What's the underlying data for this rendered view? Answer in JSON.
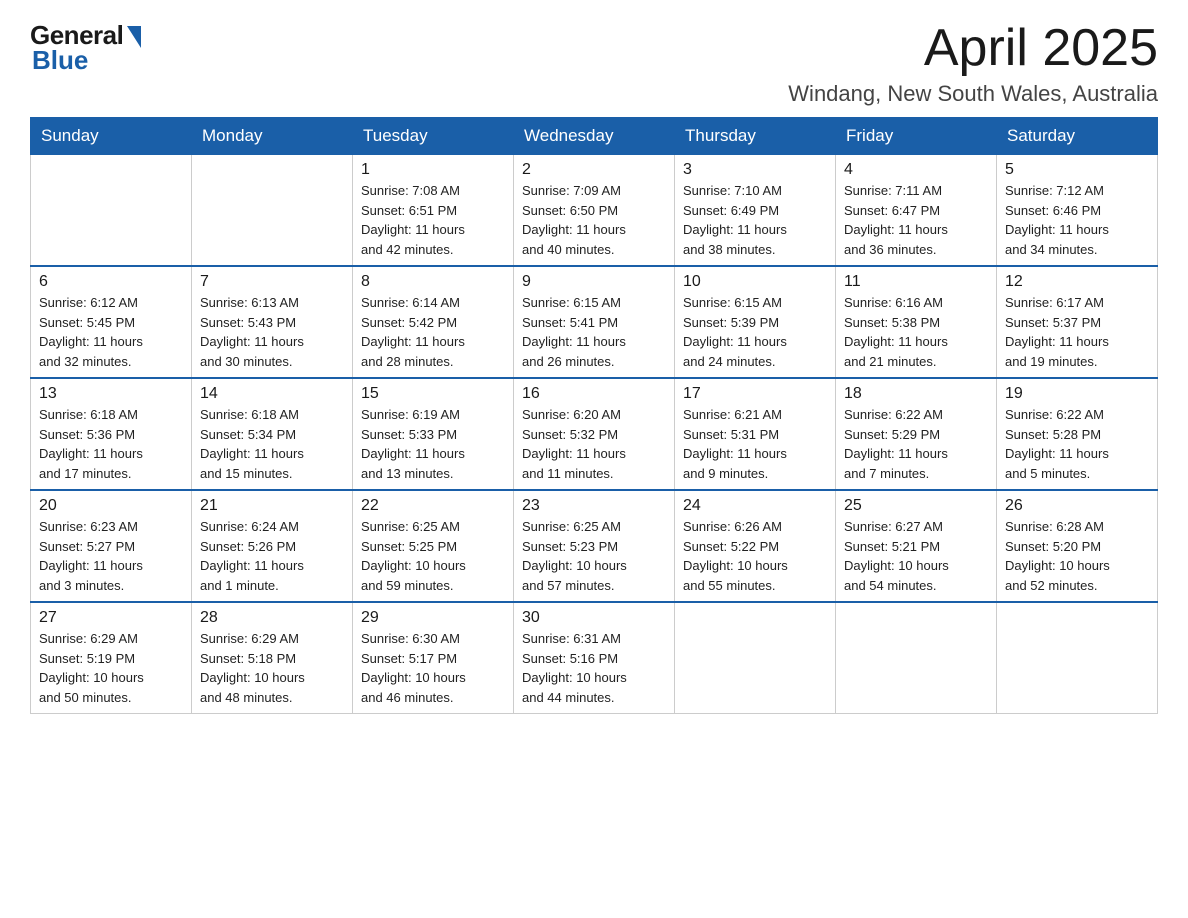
{
  "logo": {
    "general": "General",
    "blue": "Blue"
  },
  "title": "April 2025",
  "location": "Windang, New South Wales, Australia",
  "days_header": [
    "Sunday",
    "Monday",
    "Tuesday",
    "Wednesday",
    "Thursday",
    "Friday",
    "Saturday"
  ],
  "weeks": [
    [
      {
        "day": "",
        "info": ""
      },
      {
        "day": "",
        "info": ""
      },
      {
        "day": "1",
        "info": "Sunrise: 7:08 AM\nSunset: 6:51 PM\nDaylight: 11 hours\nand 42 minutes."
      },
      {
        "day": "2",
        "info": "Sunrise: 7:09 AM\nSunset: 6:50 PM\nDaylight: 11 hours\nand 40 minutes."
      },
      {
        "day": "3",
        "info": "Sunrise: 7:10 AM\nSunset: 6:49 PM\nDaylight: 11 hours\nand 38 minutes."
      },
      {
        "day": "4",
        "info": "Sunrise: 7:11 AM\nSunset: 6:47 PM\nDaylight: 11 hours\nand 36 minutes."
      },
      {
        "day": "5",
        "info": "Sunrise: 7:12 AM\nSunset: 6:46 PM\nDaylight: 11 hours\nand 34 minutes."
      }
    ],
    [
      {
        "day": "6",
        "info": "Sunrise: 6:12 AM\nSunset: 5:45 PM\nDaylight: 11 hours\nand 32 minutes."
      },
      {
        "day": "7",
        "info": "Sunrise: 6:13 AM\nSunset: 5:43 PM\nDaylight: 11 hours\nand 30 minutes."
      },
      {
        "day": "8",
        "info": "Sunrise: 6:14 AM\nSunset: 5:42 PM\nDaylight: 11 hours\nand 28 minutes."
      },
      {
        "day": "9",
        "info": "Sunrise: 6:15 AM\nSunset: 5:41 PM\nDaylight: 11 hours\nand 26 minutes."
      },
      {
        "day": "10",
        "info": "Sunrise: 6:15 AM\nSunset: 5:39 PM\nDaylight: 11 hours\nand 24 minutes."
      },
      {
        "day": "11",
        "info": "Sunrise: 6:16 AM\nSunset: 5:38 PM\nDaylight: 11 hours\nand 21 minutes."
      },
      {
        "day": "12",
        "info": "Sunrise: 6:17 AM\nSunset: 5:37 PM\nDaylight: 11 hours\nand 19 minutes."
      }
    ],
    [
      {
        "day": "13",
        "info": "Sunrise: 6:18 AM\nSunset: 5:36 PM\nDaylight: 11 hours\nand 17 minutes."
      },
      {
        "day": "14",
        "info": "Sunrise: 6:18 AM\nSunset: 5:34 PM\nDaylight: 11 hours\nand 15 minutes."
      },
      {
        "day": "15",
        "info": "Sunrise: 6:19 AM\nSunset: 5:33 PM\nDaylight: 11 hours\nand 13 minutes."
      },
      {
        "day": "16",
        "info": "Sunrise: 6:20 AM\nSunset: 5:32 PM\nDaylight: 11 hours\nand 11 minutes."
      },
      {
        "day": "17",
        "info": "Sunrise: 6:21 AM\nSunset: 5:31 PM\nDaylight: 11 hours\nand 9 minutes."
      },
      {
        "day": "18",
        "info": "Sunrise: 6:22 AM\nSunset: 5:29 PM\nDaylight: 11 hours\nand 7 minutes."
      },
      {
        "day": "19",
        "info": "Sunrise: 6:22 AM\nSunset: 5:28 PM\nDaylight: 11 hours\nand 5 minutes."
      }
    ],
    [
      {
        "day": "20",
        "info": "Sunrise: 6:23 AM\nSunset: 5:27 PM\nDaylight: 11 hours\nand 3 minutes."
      },
      {
        "day": "21",
        "info": "Sunrise: 6:24 AM\nSunset: 5:26 PM\nDaylight: 11 hours\nand 1 minute."
      },
      {
        "day": "22",
        "info": "Sunrise: 6:25 AM\nSunset: 5:25 PM\nDaylight: 10 hours\nand 59 minutes."
      },
      {
        "day": "23",
        "info": "Sunrise: 6:25 AM\nSunset: 5:23 PM\nDaylight: 10 hours\nand 57 minutes."
      },
      {
        "day": "24",
        "info": "Sunrise: 6:26 AM\nSunset: 5:22 PM\nDaylight: 10 hours\nand 55 minutes."
      },
      {
        "day": "25",
        "info": "Sunrise: 6:27 AM\nSunset: 5:21 PM\nDaylight: 10 hours\nand 54 minutes."
      },
      {
        "day": "26",
        "info": "Sunrise: 6:28 AM\nSunset: 5:20 PM\nDaylight: 10 hours\nand 52 minutes."
      }
    ],
    [
      {
        "day": "27",
        "info": "Sunrise: 6:29 AM\nSunset: 5:19 PM\nDaylight: 10 hours\nand 50 minutes."
      },
      {
        "day": "28",
        "info": "Sunrise: 6:29 AM\nSunset: 5:18 PM\nDaylight: 10 hours\nand 48 minutes."
      },
      {
        "day": "29",
        "info": "Sunrise: 6:30 AM\nSunset: 5:17 PM\nDaylight: 10 hours\nand 46 minutes."
      },
      {
        "day": "30",
        "info": "Sunrise: 6:31 AM\nSunset: 5:16 PM\nDaylight: 10 hours\nand 44 minutes."
      },
      {
        "day": "",
        "info": ""
      },
      {
        "day": "",
        "info": ""
      },
      {
        "day": "",
        "info": ""
      }
    ]
  ]
}
